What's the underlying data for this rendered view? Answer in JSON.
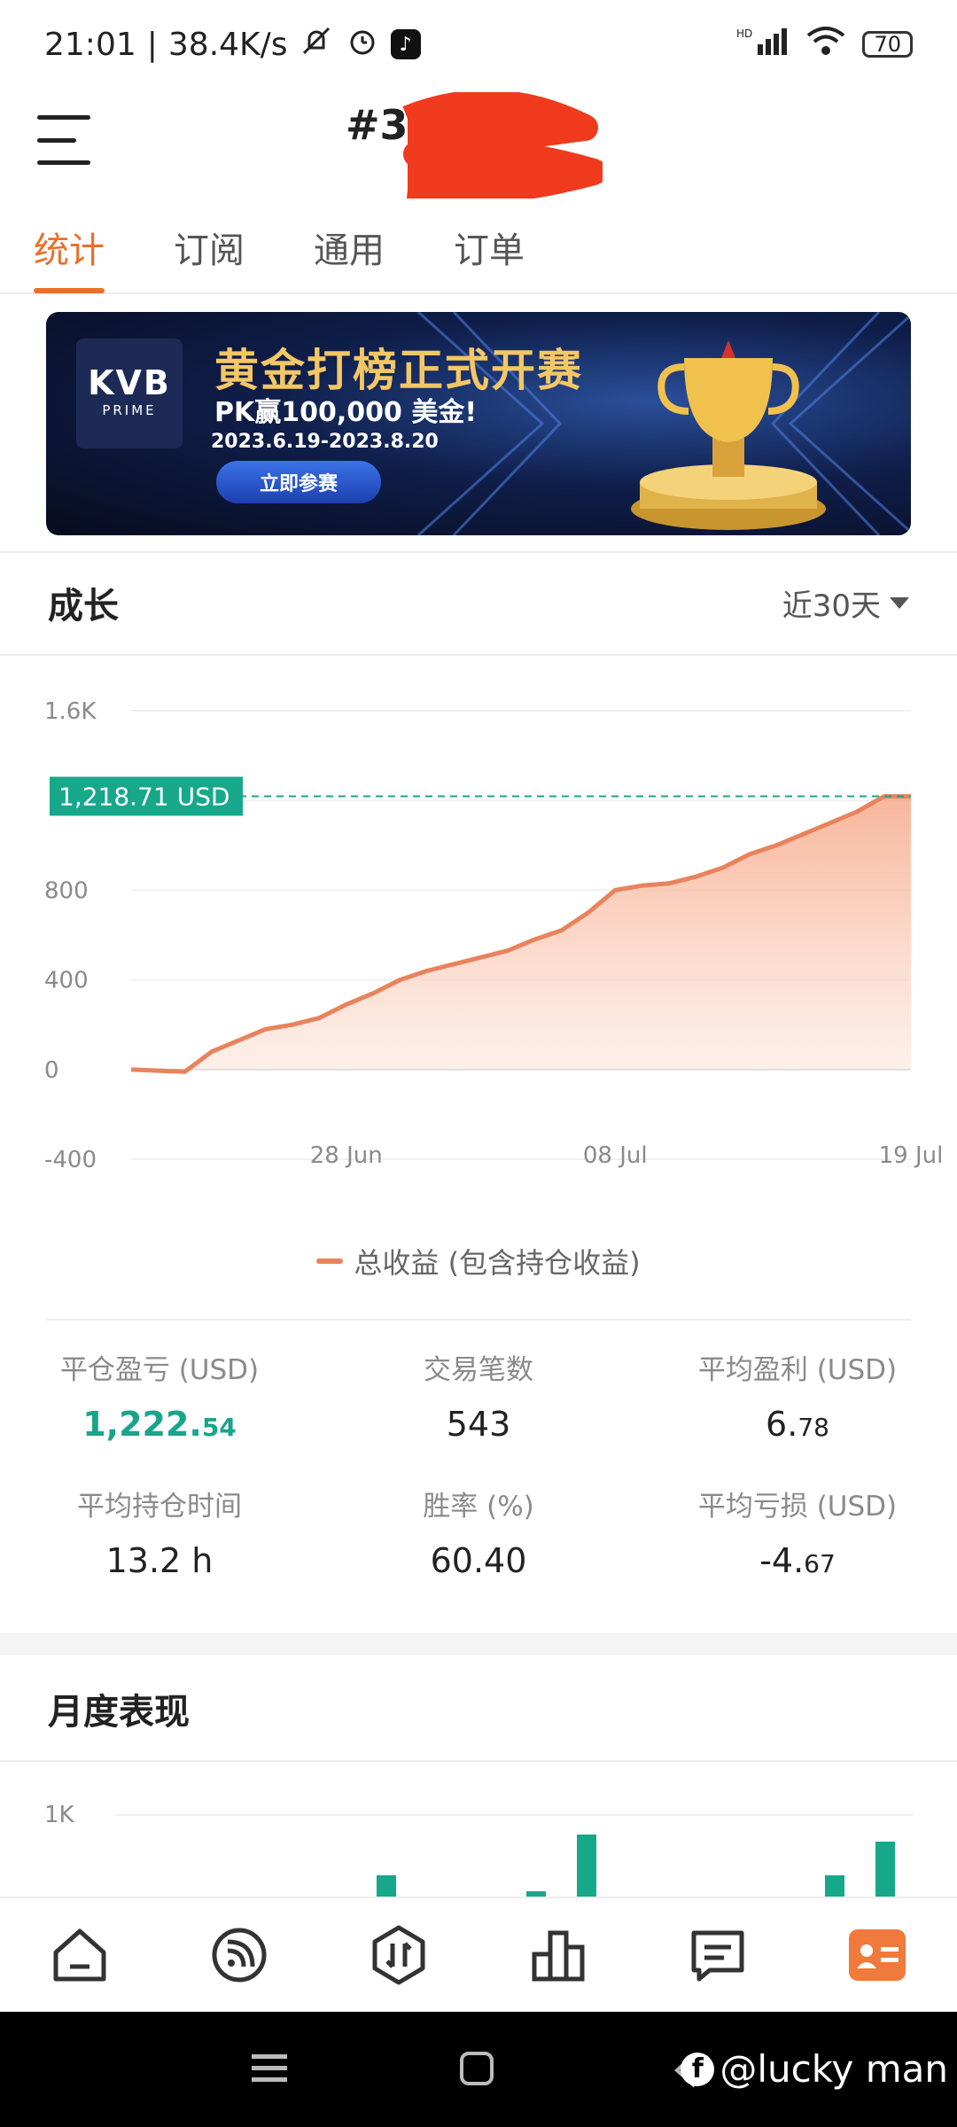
{
  "status_bar": {
    "time": "21:01",
    "net_speed": "38.4K/s",
    "signal": "HD",
    "battery": "70"
  },
  "header": {
    "title": "#3"
  },
  "tabs": [
    {
      "label": "统计",
      "active": true
    },
    {
      "label": "订阅",
      "active": false
    },
    {
      "label": "通用",
      "active": false
    },
    {
      "label": "订单",
      "active": false
    }
  ],
  "banner": {
    "logo_main": "KVB",
    "logo_sub": "PRIME",
    "title": "黄金打榜正式开赛",
    "subtitle": "PK赢100,000 美金!",
    "dates": "2023.6.19-2023.8.20",
    "button": "立即参赛"
  },
  "growth": {
    "title": "成长",
    "range": "近30天",
    "current_value": "1,218.71 USD",
    "legend": "总收益 (包含持仓收益)"
  },
  "chart_data": {
    "type": "area",
    "y_ticks": [
      "1.6K",
      "800",
      "400",
      "0",
      "-400"
    ],
    "x_ticks": [
      "28 Jun",
      "08 Jul",
      "19 Jul"
    ],
    "ylim": [
      -400,
      1600
    ],
    "x": [
      "20 Jun",
      "21 Jun",
      "22 Jun",
      "23 Jun",
      "24 Jun",
      "25 Jun",
      "26 Jun",
      "27 Jun",
      "28 Jun",
      "29 Jun",
      "30 Jun",
      "01 Jul",
      "02 Jul",
      "03 Jul",
      "04 Jul",
      "05 Jul",
      "06 Jul",
      "07 Jul",
      "08 Jul",
      "09 Jul",
      "10 Jul",
      "11 Jul",
      "12 Jul",
      "13 Jul",
      "14 Jul",
      "15 Jul",
      "16 Jul",
      "17 Jul",
      "18 Jul",
      "19 Jul"
    ],
    "series": [
      {
        "name": "总收益 (包含持仓收益)",
        "color": "#e8835c",
        "values": [
          0,
          -5,
          -10,
          80,
          130,
          180,
          200,
          230,
          290,
          340,
          400,
          440,
          470,
          500,
          530,
          580,
          620,
          700,
          800,
          820,
          830,
          860,
          900,
          960,
          1000,
          1050,
          1100,
          1150,
          1218,
          1218
        ]
      }
    ],
    "reference_line": 1218.71
  },
  "stats": [
    {
      "label": "平仓盈亏 (USD)",
      "value": "1,222.",
      "value_small": "54",
      "accent": true
    },
    {
      "label": "交易笔数",
      "value": "543",
      "value_small": "",
      "accent": false
    },
    {
      "label": "平均盈利 (USD)",
      "value": "6.",
      "value_small": "78",
      "accent": false
    },
    {
      "label": "平均持仓时间",
      "value": "13.2 h",
      "value_small": "",
      "accent": false
    },
    {
      "label": "胜率 (%)",
      "value": "60.40",
      "value_small": "",
      "accent": false
    },
    {
      "label": "平均亏损 (USD)",
      "value": "-4.",
      "value_small": "67",
      "accent": false
    }
  ],
  "monthly": {
    "title": "月度表现",
    "y_tick": "1K"
  },
  "colors": {
    "accent": "#e8702a",
    "green": "#1aa58a",
    "area": "#f9c9b5"
  },
  "watermark": "@lucky man"
}
